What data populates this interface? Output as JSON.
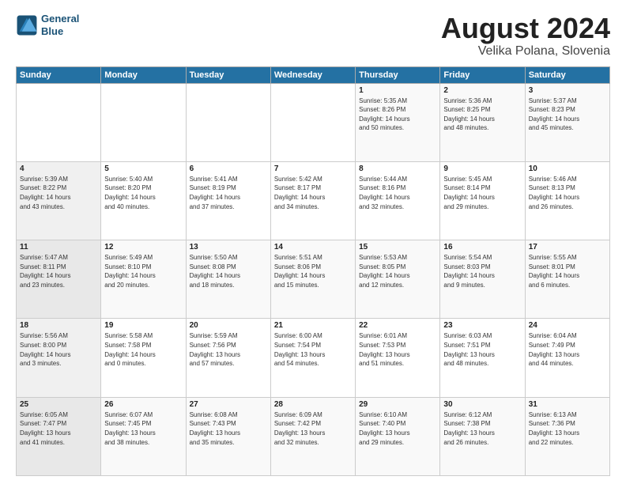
{
  "header": {
    "logo_line1": "General",
    "logo_line2": "Blue",
    "title": "August 2024",
    "subtitle": "Velika Polana, Slovenia"
  },
  "weekdays": [
    "Sunday",
    "Monday",
    "Tuesday",
    "Wednesday",
    "Thursday",
    "Friday",
    "Saturday"
  ],
  "weeks": [
    [
      {
        "day": "",
        "info": ""
      },
      {
        "day": "",
        "info": ""
      },
      {
        "day": "",
        "info": ""
      },
      {
        "day": "",
        "info": ""
      },
      {
        "day": "1",
        "info": "Sunrise: 5:35 AM\nSunset: 8:26 PM\nDaylight: 14 hours\nand 50 minutes."
      },
      {
        "day": "2",
        "info": "Sunrise: 5:36 AM\nSunset: 8:25 PM\nDaylight: 14 hours\nand 48 minutes."
      },
      {
        "day": "3",
        "info": "Sunrise: 5:37 AM\nSunset: 8:23 PM\nDaylight: 14 hours\nand 45 minutes."
      }
    ],
    [
      {
        "day": "4",
        "info": "Sunrise: 5:39 AM\nSunset: 8:22 PM\nDaylight: 14 hours\nand 43 minutes."
      },
      {
        "day": "5",
        "info": "Sunrise: 5:40 AM\nSunset: 8:20 PM\nDaylight: 14 hours\nand 40 minutes."
      },
      {
        "day": "6",
        "info": "Sunrise: 5:41 AM\nSunset: 8:19 PM\nDaylight: 14 hours\nand 37 minutes."
      },
      {
        "day": "7",
        "info": "Sunrise: 5:42 AM\nSunset: 8:17 PM\nDaylight: 14 hours\nand 34 minutes."
      },
      {
        "day": "8",
        "info": "Sunrise: 5:44 AM\nSunset: 8:16 PM\nDaylight: 14 hours\nand 32 minutes."
      },
      {
        "day": "9",
        "info": "Sunrise: 5:45 AM\nSunset: 8:14 PM\nDaylight: 14 hours\nand 29 minutes."
      },
      {
        "day": "10",
        "info": "Sunrise: 5:46 AM\nSunset: 8:13 PM\nDaylight: 14 hours\nand 26 minutes."
      }
    ],
    [
      {
        "day": "11",
        "info": "Sunrise: 5:47 AM\nSunset: 8:11 PM\nDaylight: 14 hours\nand 23 minutes."
      },
      {
        "day": "12",
        "info": "Sunrise: 5:49 AM\nSunset: 8:10 PM\nDaylight: 14 hours\nand 20 minutes."
      },
      {
        "day": "13",
        "info": "Sunrise: 5:50 AM\nSunset: 8:08 PM\nDaylight: 14 hours\nand 18 minutes."
      },
      {
        "day": "14",
        "info": "Sunrise: 5:51 AM\nSunset: 8:06 PM\nDaylight: 14 hours\nand 15 minutes."
      },
      {
        "day": "15",
        "info": "Sunrise: 5:53 AM\nSunset: 8:05 PM\nDaylight: 14 hours\nand 12 minutes."
      },
      {
        "day": "16",
        "info": "Sunrise: 5:54 AM\nSunset: 8:03 PM\nDaylight: 14 hours\nand 9 minutes."
      },
      {
        "day": "17",
        "info": "Sunrise: 5:55 AM\nSunset: 8:01 PM\nDaylight: 14 hours\nand 6 minutes."
      }
    ],
    [
      {
        "day": "18",
        "info": "Sunrise: 5:56 AM\nSunset: 8:00 PM\nDaylight: 14 hours\nand 3 minutes."
      },
      {
        "day": "19",
        "info": "Sunrise: 5:58 AM\nSunset: 7:58 PM\nDaylight: 14 hours\nand 0 minutes."
      },
      {
        "day": "20",
        "info": "Sunrise: 5:59 AM\nSunset: 7:56 PM\nDaylight: 13 hours\nand 57 minutes."
      },
      {
        "day": "21",
        "info": "Sunrise: 6:00 AM\nSunset: 7:54 PM\nDaylight: 13 hours\nand 54 minutes."
      },
      {
        "day": "22",
        "info": "Sunrise: 6:01 AM\nSunset: 7:53 PM\nDaylight: 13 hours\nand 51 minutes."
      },
      {
        "day": "23",
        "info": "Sunrise: 6:03 AM\nSunset: 7:51 PM\nDaylight: 13 hours\nand 48 minutes."
      },
      {
        "day": "24",
        "info": "Sunrise: 6:04 AM\nSunset: 7:49 PM\nDaylight: 13 hours\nand 44 minutes."
      }
    ],
    [
      {
        "day": "25",
        "info": "Sunrise: 6:05 AM\nSunset: 7:47 PM\nDaylight: 13 hours\nand 41 minutes."
      },
      {
        "day": "26",
        "info": "Sunrise: 6:07 AM\nSunset: 7:45 PM\nDaylight: 13 hours\nand 38 minutes."
      },
      {
        "day": "27",
        "info": "Sunrise: 6:08 AM\nSunset: 7:43 PM\nDaylight: 13 hours\nand 35 minutes."
      },
      {
        "day": "28",
        "info": "Sunrise: 6:09 AM\nSunset: 7:42 PM\nDaylight: 13 hours\nand 32 minutes."
      },
      {
        "day": "29",
        "info": "Sunrise: 6:10 AM\nSunset: 7:40 PM\nDaylight: 13 hours\nand 29 minutes."
      },
      {
        "day": "30",
        "info": "Sunrise: 6:12 AM\nSunset: 7:38 PM\nDaylight: 13 hours\nand 26 minutes."
      },
      {
        "day": "31",
        "info": "Sunrise: 6:13 AM\nSunset: 7:36 PM\nDaylight: 13 hours\nand 22 minutes."
      }
    ]
  ]
}
